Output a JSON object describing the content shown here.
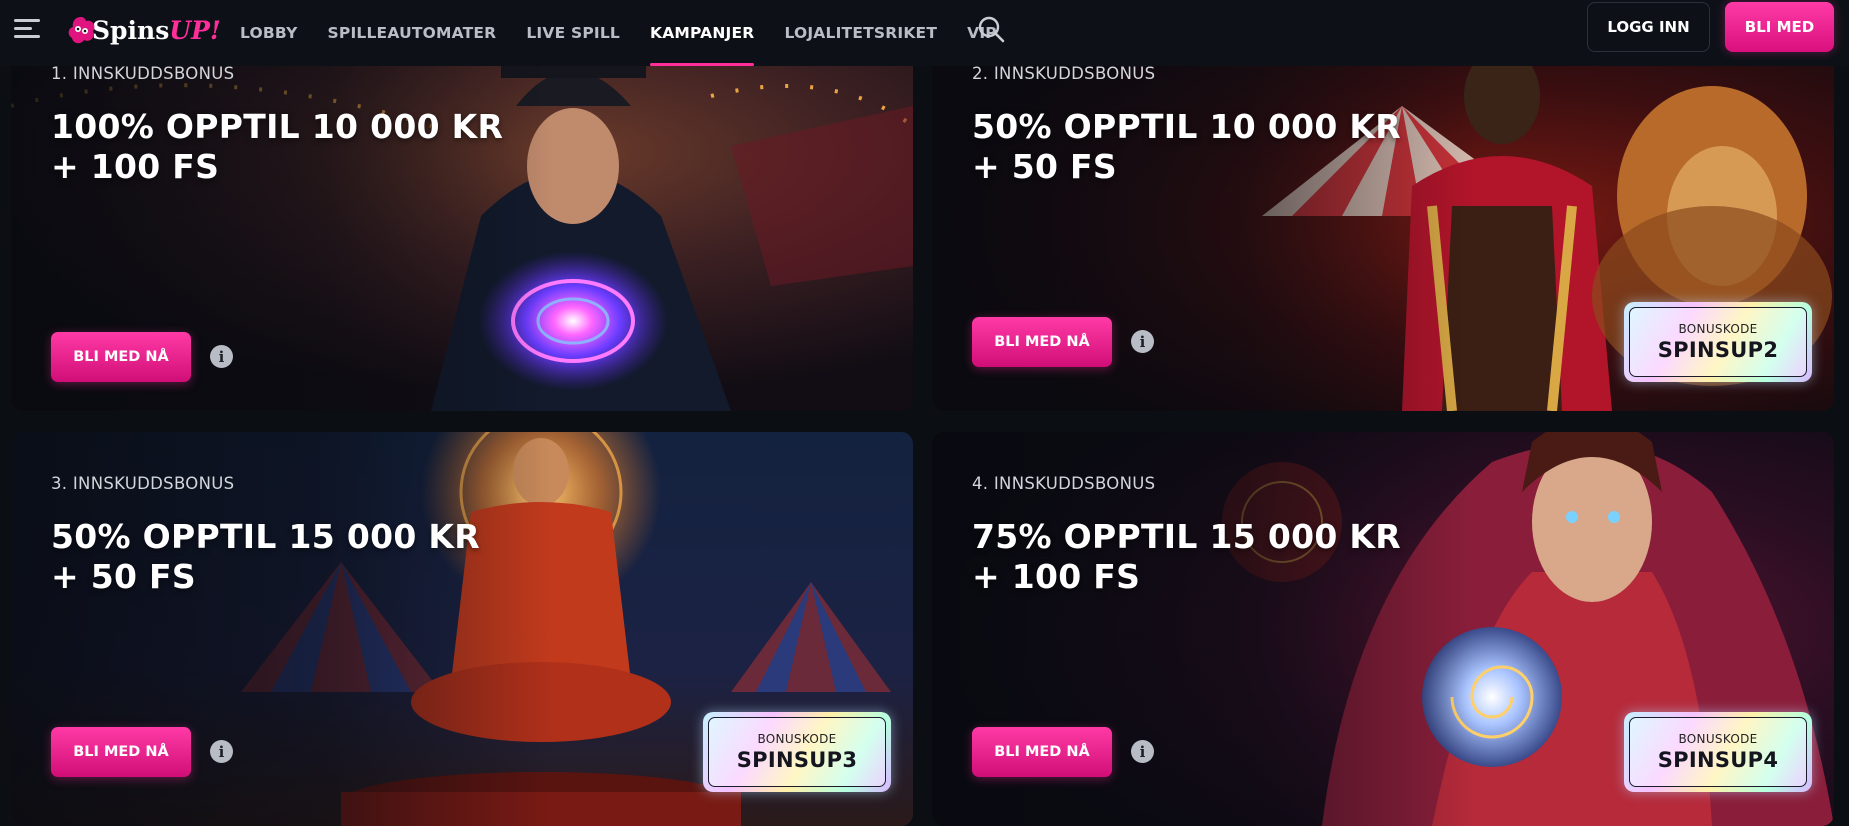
{
  "header": {
    "logo": {
      "text_main": "Spins",
      "text_accent": "UP!"
    },
    "nav": [
      {
        "label": "LOBBY",
        "active": false
      },
      {
        "label": "SPILLEAUTOMATER",
        "active": false
      },
      {
        "label": "LIVE SPILL",
        "active": false
      },
      {
        "label": "KAMPANJER",
        "active": true
      },
      {
        "label": "LOJALITETSRIKET",
        "active": false
      },
      {
        "label": "VIP",
        "active": false
      }
    ],
    "login_label": "LOGG INN",
    "join_label": "BLI MED"
  },
  "promotions": [
    {
      "label": "1. INNSKUDDSBONUS",
      "title_line1": "100% OPPTIL 10 000 KR",
      "title_line2": "+ 100 FS",
      "cta": "BLI MED NÅ",
      "bonus_label": "",
      "bonus_code": ""
    },
    {
      "label": "2. INNSKUDDSBONUS",
      "title_line1": "50% OPPTIL 10 000 KR",
      "title_line2": "+ 50 FS",
      "cta": "BLI MED NÅ",
      "bonus_label": "BONUSKODE",
      "bonus_code": "SPINSUP2"
    },
    {
      "label": "3. INNSKUDDSBONUS",
      "title_line1": "50% OPPTIL 15 000 KR",
      "title_line2": "+ 50 FS",
      "cta": "BLI MED NÅ",
      "bonus_label": "BONUSKODE",
      "bonus_code": "SPINSUP3"
    },
    {
      "label": "4. INNSKUDDSBONUS",
      "title_line1": "75% OPPTIL 15 000 KR",
      "title_line2": "+ 100 FS",
      "cta": "BLI MED NÅ",
      "bonus_label": "BONUSKODE",
      "bonus_code": "SPINSUP4"
    }
  ],
  "colors": {
    "accent": "#ff2e9a",
    "background": "#0b0f14",
    "header": "#0d1117"
  },
  "icons": [
    "menu-icon",
    "logo-icon",
    "search-icon",
    "info-icon"
  ]
}
